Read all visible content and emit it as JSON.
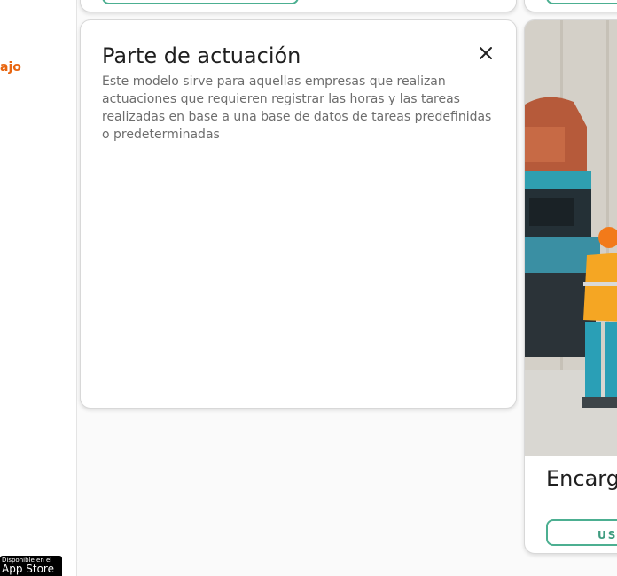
{
  "sidebar": {
    "link_label": "ajo",
    "store_badge": {
      "small_text": "Disponible en el",
      "big_text": "App Store"
    }
  },
  "modal_card": {
    "title": "Parte de actuación",
    "description": "Este modelo sirve para aquellas empresas que realizan actuaciones que requieren registrar las horas y las tareas realizadas en base a una base de datos de tareas predefinidas o predeterminadas"
  },
  "right_card": {
    "title": "Encarg",
    "button_label": "USA"
  },
  "colors": {
    "accent_orange": "#e8650f",
    "button_green": "#4caf91",
    "background": "#fafafa"
  }
}
